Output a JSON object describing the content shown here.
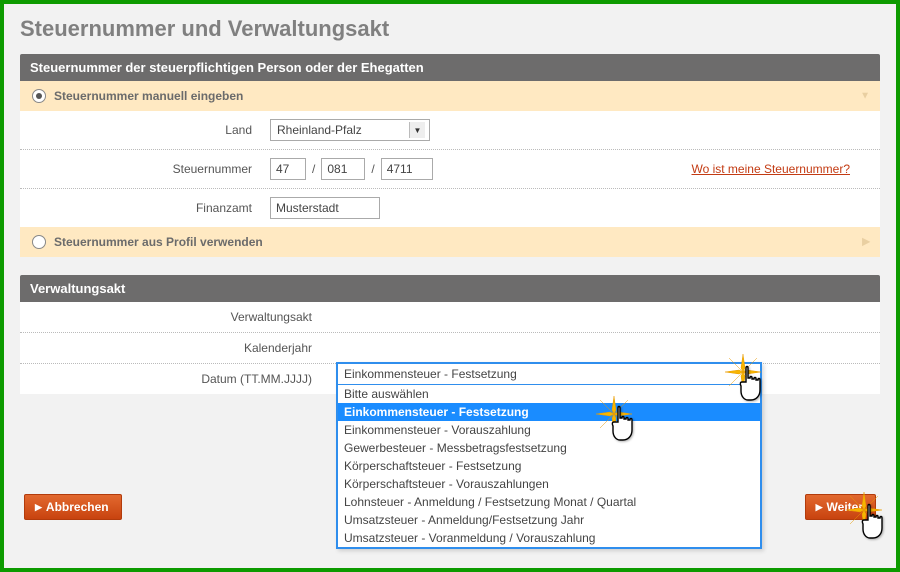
{
  "title": "Steuernummer und Verwaltungsakt",
  "section1": {
    "header": "Steuernummer der steuerpflichtigen Person oder der Ehegatten",
    "opt_manual": "Steuernummer manuell eingeben",
    "opt_profile": "Steuernummer aus Profil verwenden",
    "land_label": "Land",
    "land_value": "Rheinland-Pfalz",
    "stnr_label": "Steuernummer",
    "stnr_sep": "/",
    "stnr_p1": "47",
    "stnr_p2": "081",
    "stnr_p3": "4711",
    "help_link": "Wo ist meine Steuernummer?",
    "finanzamt_label": "Finanzamt",
    "finanzamt_value": "Musterstadt"
  },
  "section2": {
    "header": "Verwaltungsakt",
    "akt_label": "Verwaltungsakt",
    "akt_selected": "Einkommensteuer - Festsetzung",
    "akt_options": [
      "Bitte auswählen",
      "Einkommensteuer - Festsetzung",
      "Einkommensteuer - Vorauszahlung",
      "Gewerbesteuer - Messbetragsfestsetzung",
      "Körperschaftsteuer - Festsetzung",
      "Körperschaftsteuer - Vorauszahlungen",
      "Lohnsteuer - Anmeldung / Festsetzung Monat / Quartal",
      "Umsatzsteuer - Anmeldung/Festsetzung Jahr",
      "Umsatzsteuer - Voranmeldung / Vorauszahlung"
    ],
    "jahr_label": "Kalenderjahr",
    "datum_label": "Datum (TT.MM.JJJJ)"
  },
  "buttons": {
    "cancel": "Abbrechen",
    "next": "Weiter"
  },
  "colors": {
    "accent_orange": "#d54812",
    "frame_green": "#0d9b00",
    "highlight_blue": "#1a8cff"
  }
}
